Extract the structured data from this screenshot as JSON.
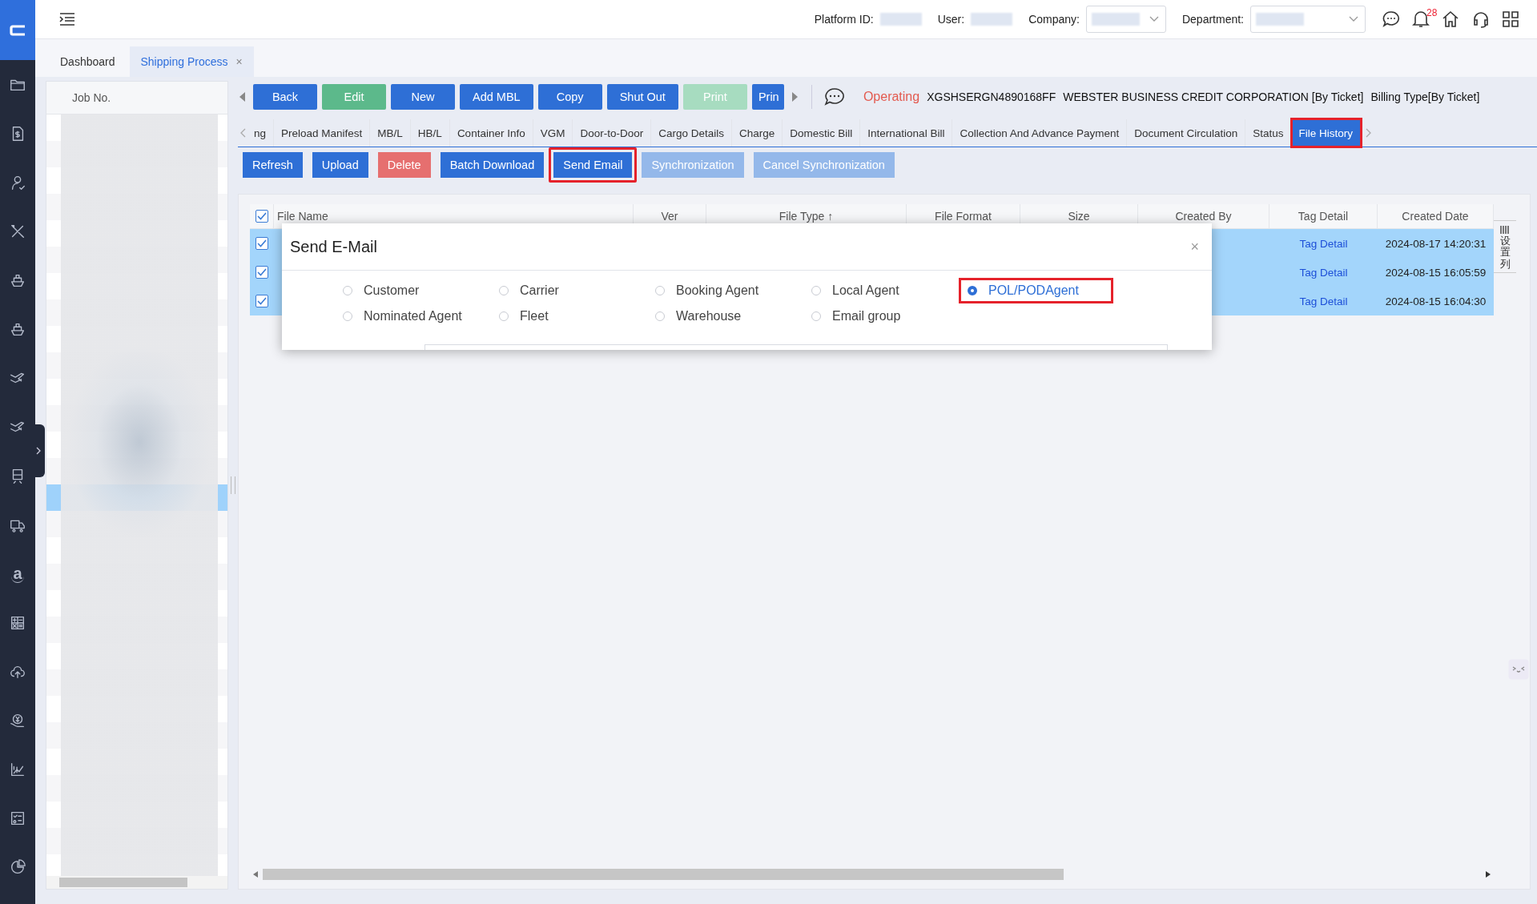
{
  "sidebar": {
    "items": [
      {
        "kind": "folder"
      },
      {
        "kind": "invoice"
      },
      {
        "kind": "person"
      },
      {
        "kind": "tools"
      },
      {
        "kind": "ship"
      },
      {
        "kind": "ship"
      },
      {
        "kind": "plane"
      },
      {
        "kind": "plane"
      },
      {
        "kind": "train"
      },
      {
        "kind": "truck"
      },
      {
        "kind": "letter",
        "text": "a"
      },
      {
        "kind": "calculator"
      },
      {
        "kind": "cloud"
      },
      {
        "kind": "coin"
      },
      {
        "kind": "chart"
      },
      {
        "kind": "checklist"
      },
      {
        "kind": "pie"
      }
    ]
  },
  "top_bar": {
    "fields": [
      {
        "label": "Platform ID:",
        "kind": "value"
      },
      {
        "label": "User:",
        "kind": "value"
      },
      {
        "label": "Company:",
        "kind": "dropdown"
      },
      {
        "label": "Department:",
        "kind": "dropdown"
      }
    ],
    "notification_count": "28"
  },
  "page_tabs": [
    {
      "label": "Dashboard",
      "selected": false
    },
    {
      "label": "Shipping Process",
      "selected": true,
      "close": "×"
    }
  ],
  "job_panel": {
    "header": "Job No."
  },
  "toolbar": {
    "buttons": [
      {
        "label": "Back",
        "kind": "primary",
        "disabled": false
      },
      {
        "label": "Edit",
        "kind": "success",
        "disabled": false
      },
      {
        "label": "New",
        "kind": "primary",
        "disabled": false
      },
      {
        "label": "Add MBL",
        "kind": "primary",
        "disabled": false
      },
      {
        "label": "Copy",
        "kind": "primary",
        "disabled": false
      },
      {
        "label": "Shut Out",
        "kind": "primary",
        "disabled": false
      },
      {
        "label": "Print",
        "kind": "success",
        "disabled": true
      },
      {
        "label": "Prin",
        "kind": "primary",
        "disabled": false
      }
    ],
    "status": "Operating",
    "job_no": "XGSHSERGN4890168FF",
    "company": "WEBSTER BUSINESS CREDIT CORPORATION [By Ticket]",
    "billing_type": "Billing Type[By Ticket]"
  },
  "tabs": [
    {
      "label": "ng",
      "selected": false,
      "highlighted": false
    },
    {
      "label": "Preload Manifest",
      "selected": false,
      "highlighted": false
    },
    {
      "label": "MB/L",
      "selected": false,
      "highlighted": false
    },
    {
      "label": "HB/L",
      "selected": false,
      "highlighted": false
    },
    {
      "label": "Container Info",
      "selected": false,
      "highlighted": false
    },
    {
      "label": "VGM",
      "selected": false,
      "highlighted": false
    },
    {
      "label": "Door-to-Door",
      "selected": false,
      "highlighted": false
    },
    {
      "label": "Cargo Details",
      "selected": false,
      "highlighted": false
    },
    {
      "label": "Charge",
      "selected": false,
      "highlighted": false
    },
    {
      "label": "Domestic Bill",
      "selected": false,
      "highlighted": false
    },
    {
      "label": "International Bill",
      "selected": false,
      "highlighted": false
    },
    {
      "label": "Collection And Advance Payment",
      "selected": false,
      "highlighted": false
    },
    {
      "label": "Document Circulation",
      "selected": false,
      "highlighted": false
    },
    {
      "label": "Status",
      "selected": false,
      "highlighted": false
    },
    {
      "label": "File History",
      "selected": true,
      "highlighted": true
    }
  ],
  "actions": [
    {
      "label": "Refresh",
      "kind": "primary",
      "disabled": false,
      "highlighted": false
    },
    {
      "label": "Upload",
      "kind": "primary",
      "disabled": false,
      "highlighted": false
    },
    {
      "label": "Delete",
      "kind": "danger",
      "disabled": false,
      "highlighted": false
    },
    {
      "label": "Batch Download",
      "kind": "primary",
      "disabled": false,
      "highlighted": false
    },
    {
      "label": "Send Email",
      "kind": "primary",
      "disabled": false,
      "highlighted": true
    },
    {
      "label": "Synchronization",
      "kind": "primary",
      "disabled": true,
      "highlighted": false
    },
    {
      "label": "Cancel Synchronization",
      "kind": "primary",
      "disabled": true,
      "highlighted": false
    }
  ],
  "table": {
    "all_checked": true,
    "columns": [
      "File Name",
      "Ver",
      "File Type ↑",
      "File Format",
      "Size",
      "Created By",
      "Tag Detail",
      "Created Date"
    ],
    "rows": [
      {
        "checked": true,
        "selected": true,
        "tag_detail": "Tag Detail",
        "created_date": "2024-08-17 14:20:31"
      },
      {
        "checked": true,
        "selected": true,
        "tag_detail": "Tag Detail",
        "created_date": "2024-08-15 16:05:59"
      },
      {
        "checked": true,
        "selected": true,
        "tag_detail": "Tag Detail",
        "created_date": "2024-08-15 16:04:30"
      }
    ]
  },
  "column_settings": {
    "label": "设置列"
  },
  "modal": {
    "title": "Send E-Mail",
    "close": "×",
    "options": [
      {
        "label": "Customer",
        "selected": false,
        "highlighted": false
      },
      {
        "label": "Carrier",
        "selected": false,
        "highlighted": false
      },
      {
        "label": "Booking Agent",
        "selected": false,
        "highlighted": false
      },
      {
        "label": "Local Agent",
        "selected": false,
        "highlighted": false
      },
      {
        "label": "POL/PODAgent",
        "selected": true,
        "highlighted": true
      },
      {
        "label": "Nominated Agent",
        "selected": false,
        "highlighted": false
      },
      {
        "label": "Fleet",
        "selected": false,
        "highlighted": false
      },
      {
        "label": "Warehouse",
        "selected": false,
        "highlighted": false
      },
      {
        "label": "Email group",
        "selected": false,
        "highlighted": false
      }
    ]
  }
}
